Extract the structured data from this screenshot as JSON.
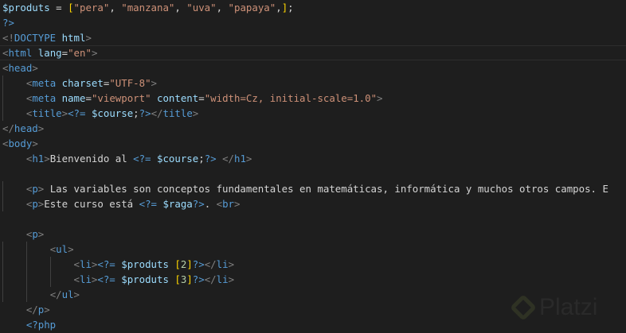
{
  "editor": {
    "current_line": 3,
    "lines": [
      [
        {
          "t": "$produts",
          "c": "var"
        },
        {
          "t": " = ",
          "c": "txt"
        },
        {
          "t": "[",
          "c": "brk"
        },
        {
          "t": "\"pera\"",
          "c": "str"
        },
        {
          "t": ", ",
          "c": "txt"
        },
        {
          "t": "\"manzana\"",
          "c": "str"
        },
        {
          "t": ", ",
          "c": "txt"
        },
        {
          "t": "\"uva\"",
          "c": "str"
        },
        {
          "t": ", ",
          "c": "txt"
        },
        {
          "t": "\"papaya\"",
          "c": "str"
        },
        {
          "t": ",",
          "c": "txt"
        },
        {
          "t": "]",
          "c": "brk"
        },
        {
          "t": ";",
          "c": "txt"
        }
      ],
      [
        {
          "t": "?>",
          "c": "php"
        }
      ],
      [
        {
          "t": "<!",
          "c": "punc"
        },
        {
          "t": "DOCTYPE",
          "c": "tag"
        },
        {
          "t": " html",
          "c": "attr"
        },
        {
          "t": ">",
          "c": "punc"
        }
      ],
      [
        {
          "t": "<",
          "c": "punc"
        },
        {
          "t": "html",
          "c": "tag"
        },
        {
          "t": " lang",
          "c": "attr"
        },
        {
          "t": "=",
          "c": "txt"
        },
        {
          "t": "\"en\"",
          "c": "str"
        },
        {
          "t": ">",
          "c": "punc"
        }
      ],
      [
        {
          "t": "<",
          "c": "punc"
        },
        {
          "t": "head",
          "c": "tag"
        },
        {
          "t": ">",
          "c": "punc"
        }
      ],
      [
        {
          "t": "    ",
          "c": "txt"
        },
        {
          "t": "<",
          "c": "punc"
        },
        {
          "t": "meta",
          "c": "tag"
        },
        {
          "t": " charset",
          "c": "attr"
        },
        {
          "t": "=",
          "c": "txt"
        },
        {
          "t": "\"UTF-8\"",
          "c": "str"
        },
        {
          "t": ">",
          "c": "punc"
        }
      ],
      [
        {
          "t": "    ",
          "c": "txt"
        },
        {
          "t": "<",
          "c": "punc"
        },
        {
          "t": "meta",
          "c": "tag"
        },
        {
          "t": " name",
          "c": "attr"
        },
        {
          "t": "=",
          "c": "txt"
        },
        {
          "t": "\"viewport\"",
          "c": "str"
        },
        {
          "t": " content",
          "c": "attr"
        },
        {
          "t": "=",
          "c": "txt"
        },
        {
          "t": "\"width=Cz, initial-scale=1.0\"",
          "c": "str"
        },
        {
          "t": ">",
          "c": "punc"
        }
      ],
      [
        {
          "t": "    ",
          "c": "txt"
        },
        {
          "t": "<",
          "c": "punc"
        },
        {
          "t": "title",
          "c": "tag"
        },
        {
          "t": ">",
          "c": "punc"
        },
        {
          "t": "<?=",
          "c": "php"
        },
        {
          "t": " $course",
          "c": "var"
        },
        {
          "t": ";",
          "c": "txt"
        },
        {
          "t": "?>",
          "c": "php"
        },
        {
          "t": "</",
          "c": "punc"
        },
        {
          "t": "title",
          "c": "tag"
        },
        {
          "t": ">",
          "c": "punc"
        }
      ],
      [
        {
          "t": "</",
          "c": "punc"
        },
        {
          "t": "head",
          "c": "tag"
        },
        {
          "t": ">",
          "c": "punc"
        }
      ],
      [
        {
          "t": "<",
          "c": "punc"
        },
        {
          "t": "body",
          "c": "tag"
        },
        {
          "t": ">",
          "c": "punc"
        }
      ],
      [
        {
          "t": "    ",
          "c": "txt"
        },
        {
          "t": "<",
          "c": "punc"
        },
        {
          "t": "h1",
          "c": "tag"
        },
        {
          "t": ">",
          "c": "punc"
        },
        {
          "t": "Bienvenido al ",
          "c": "txt"
        },
        {
          "t": "<?=",
          "c": "php"
        },
        {
          "t": " $course",
          "c": "var"
        },
        {
          "t": ";",
          "c": "txt"
        },
        {
          "t": "?>",
          "c": "php"
        },
        {
          "t": " ",
          "c": "txt"
        },
        {
          "t": "</",
          "c": "punc"
        },
        {
          "t": "h1",
          "c": "tag"
        },
        {
          "t": ">",
          "c": "punc"
        }
      ],
      [],
      [
        {
          "t": "    ",
          "c": "txt"
        },
        {
          "t": "<",
          "c": "punc"
        },
        {
          "t": "p",
          "c": "tag"
        },
        {
          "t": ">",
          "c": "punc"
        },
        {
          "t": " Las variables son conceptos fundamentales en matemáticas, informática y muchos otros campos. E",
          "c": "txt"
        }
      ],
      [
        {
          "t": "    ",
          "c": "txt"
        },
        {
          "t": "<",
          "c": "punc"
        },
        {
          "t": "p",
          "c": "tag"
        },
        {
          "t": ">",
          "c": "punc"
        },
        {
          "t": "Este curso está ",
          "c": "txt"
        },
        {
          "t": "<?=",
          "c": "php"
        },
        {
          "t": " $raga",
          "c": "var"
        },
        {
          "t": "?>",
          "c": "php"
        },
        {
          "t": ". ",
          "c": "txt"
        },
        {
          "t": "<",
          "c": "punc"
        },
        {
          "t": "br",
          "c": "tag"
        },
        {
          "t": ">",
          "c": "punc"
        }
      ],
      [],
      [
        {
          "t": "    ",
          "c": "txt"
        },
        {
          "t": "<",
          "c": "punc"
        },
        {
          "t": "p",
          "c": "tag"
        },
        {
          "t": ">",
          "c": "punc"
        }
      ],
      [
        {
          "t": "        ",
          "c": "txt"
        },
        {
          "t": "<",
          "c": "punc"
        },
        {
          "t": "ul",
          "c": "tag"
        },
        {
          "t": ">",
          "c": "punc"
        }
      ],
      [
        {
          "t": "            ",
          "c": "txt"
        },
        {
          "t": "<",
          "c": "punc"
        },
        {
          "t": "li",
          "c": "tag"
        },
        {
          "t": ">",
          "c": "punc"
        },
        {
          "t": "<?=",
          "c": "php"
        },
        {
          "t": " $produts ",
          "c": "var"
        },
        {
          "t": "[",
          "c": "brk"
        },
        {
          "t": "2",
          "c": "num"
        },
        {
          "t": "]",
          "c": "brk"
        },
        {
          "t": "?>",
          "c": "php"
        },
        {
          "t": "</",
          "c": "punc"
        },
        {
          "t": "li",
          "c": "tag"
        },
        {
          "t": ">",
          "c": "punc"
        }
      ],
      [
        {
          "t": "            ",
          "c": "txt"
        },
        {
          "t": "<",
          "c": "punc"
        },
        {
          "t": "li",
          "c": "tag"
        },
        {
          "t": ">",
          "c": "punc"
        },
        {
          "t": "<?=",
          "c": "php"
        },
        {
          "t": " $produts ",
          "c": "var"
        },
        {
          "t": "[",
          "c": "brk"
        },
        {
          "t": "3",
          "c": "num"
        },
        {
          "t": "]",
          "c": "brk"
        },
        {
          "t": "?>",
          "c": "php"
        },
        {
          "t": "</",
          "c": "punc"
        },
        {
          "t": "li",
          "c": "tag"
        },
        {
          "t": ">",
          "c": "punc"
        }
      ],
      [
        {
          "t": "        ",
          "c": "txt"
        },
        {
          "t": "</",
          "c": "punc"
        },
        {
          "t": "ul",
          "c": "tag"
        },
        {
          "t": ">",
          "c": "punc"
        }
      ],
      [
        {
          "t": "    ",
          "c": "txt"
        },
        {
          "t": "</",
          "c": "punc"
        },
        {
          "t": "p",
          "c": "tag"
        },
        {
          "t": ">",
          "c": "punc"
        }
      ],
      [
        {
          "t": "    ",
          "c": "txt"
        },
        {
          "t": "<?php",
          "c": "php"
        }
      ]
    ]
  },
  "watermark": {
    "text": "Platzi"
  }
}
